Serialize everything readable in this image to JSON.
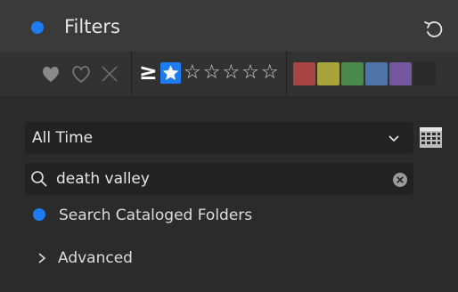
{
  "panel": {
    "title": "Filters",
    "accent_color": "#1e7cf0",
    "reset_icon": "reset-icon"
  },
  "rating_bar": {
    "flag_icons": [
      "heart-filled-icon",
      "heart-outline-icon",
      "x-icon"
    ],
    "comparator": "≥",
    "stars_text": "☆☆☆☆☆",
    "selected_star_icon": "star-icon",
    "color_labels": [
      "#a84444",
      "#a8a33a",
      "#4a8a4a",
      "#4f74a8",
      "#7456a0"
    ]
  },
  "date_filter": {
    "selected": "All Time",
    "chevron_icon": "chevron-down-icon",
    "calendar_icon": "calendar-icon"
  },
  "search": {
    "value": "death valley",
    "search_icon": "search-icon",
    "clear_icon": "clear-icon"
  },
  "options": {
    "search_cataloged": "Search Cataloged Folders",
    "advanced": "Advanced"
  }
}
